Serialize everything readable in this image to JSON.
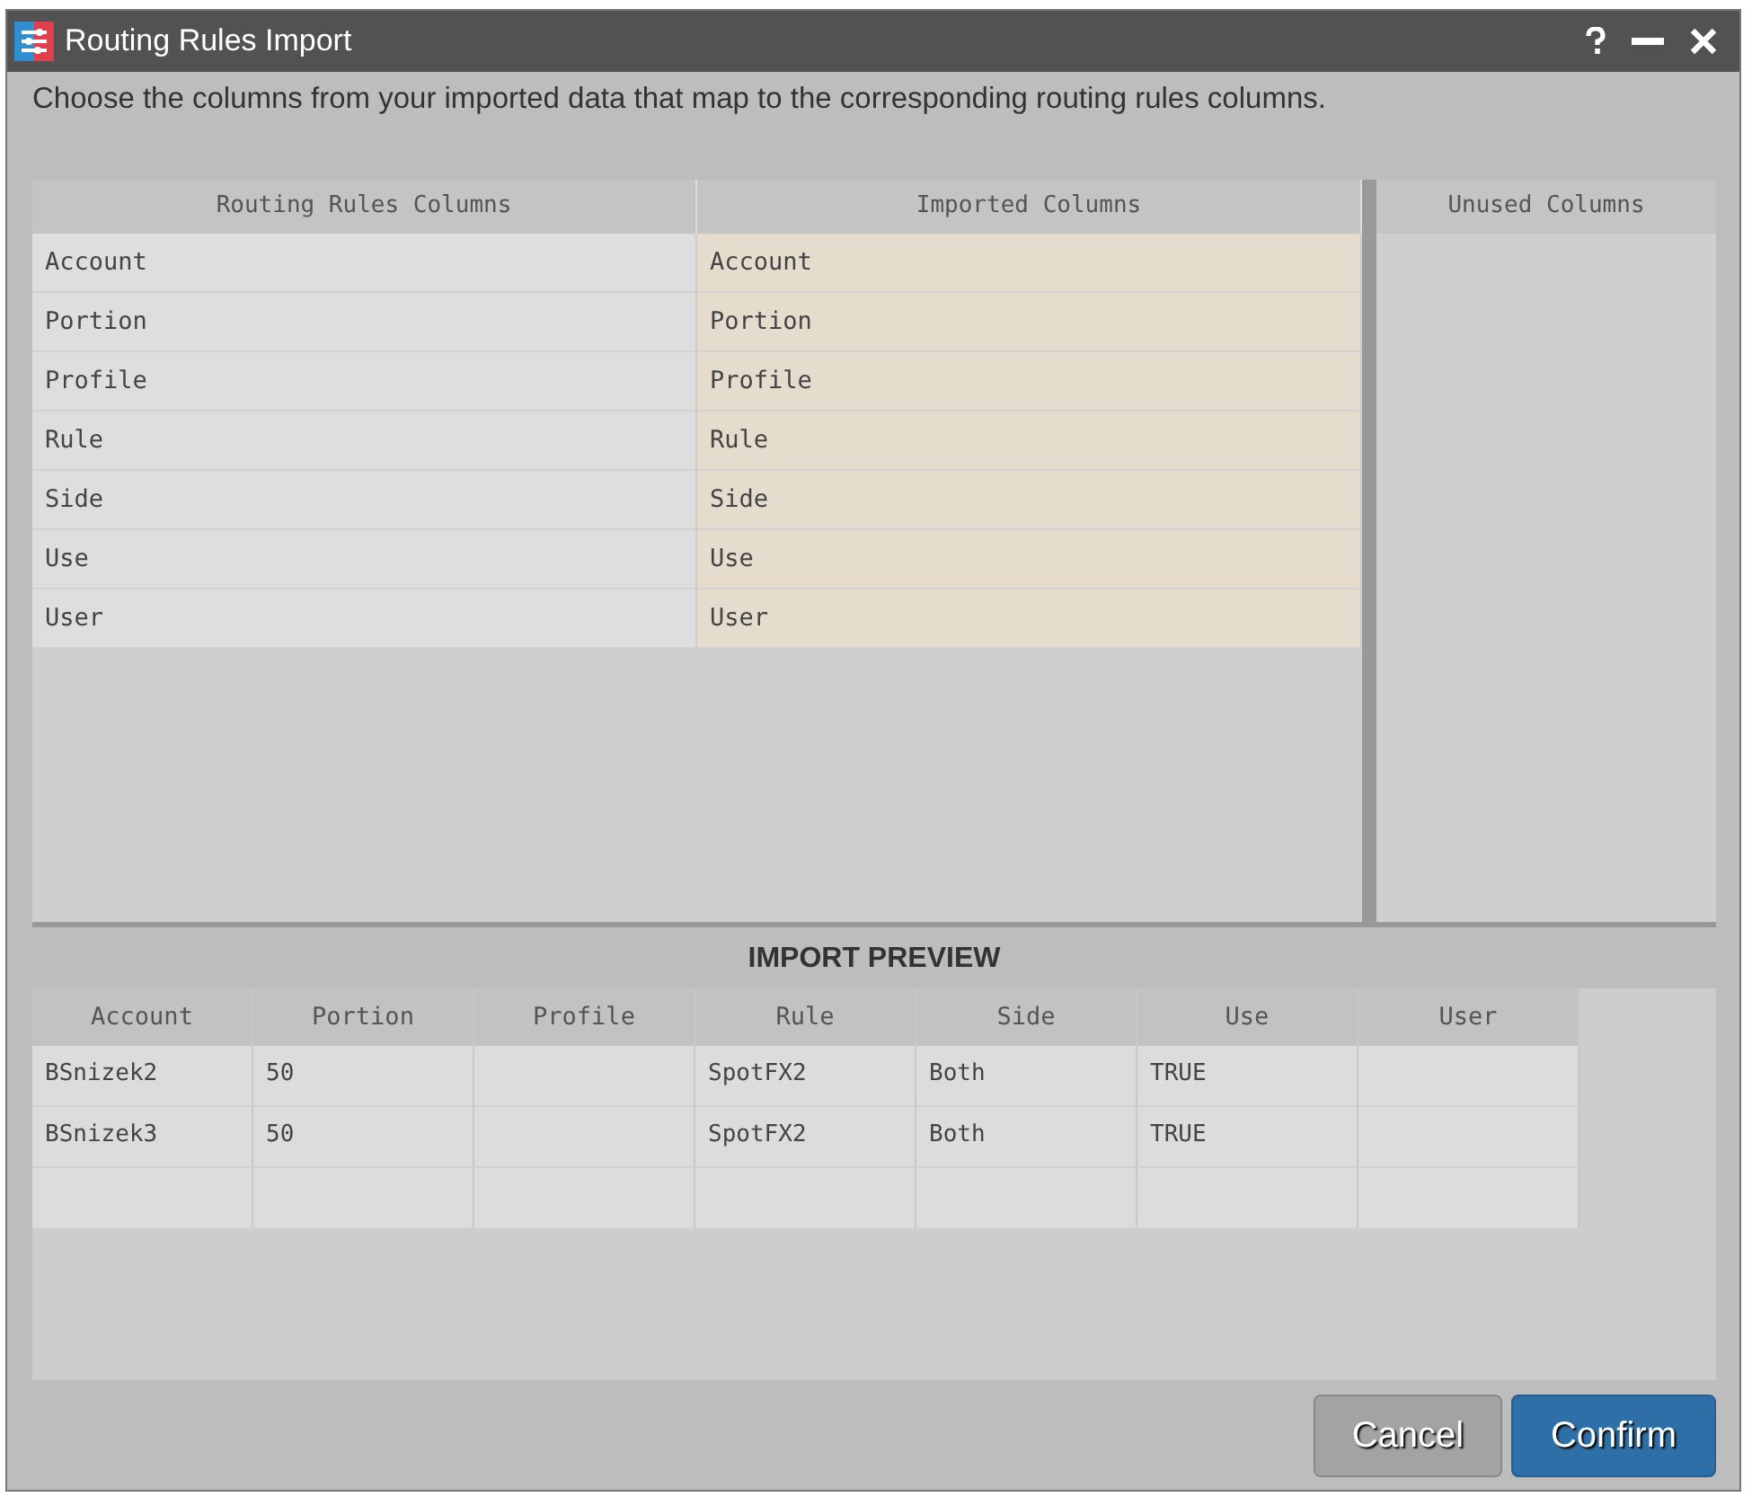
{
  "window": {
    "title": "Routing Rules Import"
  },
  "instructions": "Choose the columns from your imported data that map to the corresponding routing rules columns.",
  "mapping": {
    "columns": [
      "Routing Rules Columns",
      "Imported Columns"
    ],
    "rows": [
      {
        "routing": "Account",
        "imported": "Account"
      },
      {
        "routing": "Portion",
        "imported": "Portion"
      },
      {
        "routing": "Profile",
        "imported": "Profile"
      },
      {
        "routing": "Rule",
        "imported": "Rule"
      },
      {
        "routing": "Side",
        "imported": "Side"
      },
      {
        "routing": "Use",
        "imported": "Use"
      },
      {
        "routing": "User",
        "imported": "User"
      }
    ]
  },
  "unused": {
    "title": "Unused Columns"
  },
  "preview": {
    "title": "IMPORT PREVIEW",
    "columns": [
      "Account",
      "Portion",
      "Profile",
      "Rule",
      "Side",
      "Use",
      "User"
    ],
    "rows": [
      [
        "BSnizek2",
        "50",
        null,
        "SpotFX2",
        "Both",
        "TRUE",
        null
      ],
      [
        "BSnizek3",
        "50",
        null,
        "SpotFX2",
        "Both",
        "TRUE",
        null
      ]
    ]
  },
  "buttons": [
    {
      "label": "Cancel",
      "kind": "secondary"
    },
    {
      "label": "Confirm",
      "kind": "primary"
    }
  ]
}
